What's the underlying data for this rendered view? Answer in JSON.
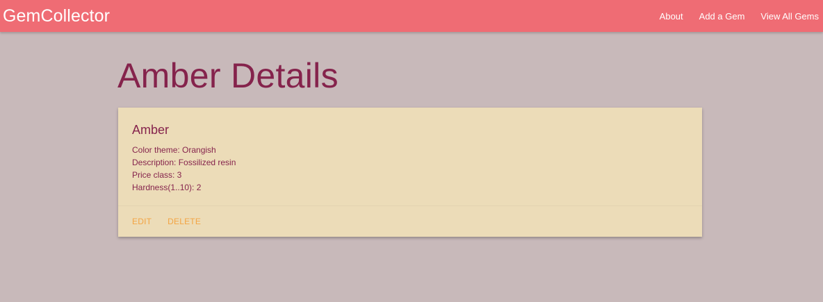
{
  "navbar": {
    "brand": "GemCollector",
    "links": [
      "About",
      "Add a Gem",
      "View All Gems"
    ]
  },
  "page": {
    "title": "Amber Details"
  },
  "gem": {
    "name": "Amber",
    "details": [
      "Color theme: Orangish",
      "Description: Fossilized resin",
      "Price class: 3",
      "Hardness(1..10): 2"
    ],
    "actions": [
      "EDIT",
      "DELETE"
    ]
  },
  "colors": {
    "background": "#c8b9ba",
    "navbar": "#ef6c74",
    "card": "#ecdcb8",
    "title_text": "#85234c",
    "action_text": "#f3a443"
  }
}
